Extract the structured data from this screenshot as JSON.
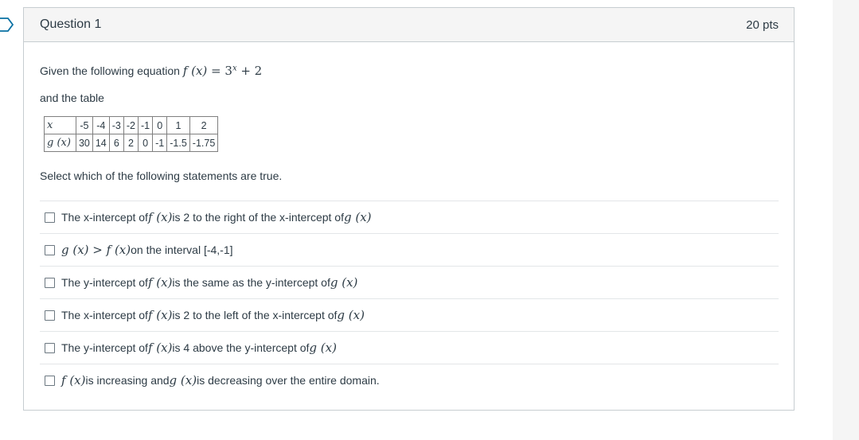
{
  "question": {
    "title": "Question 1",
    "points": "20 pts",
    "prompt_text": "Given the following equation",
    "equation": {
      "fx": "f (x)",
      "eq": " = 3",
      "exp": "x",
      "tail": " + 2"
    },
    "table_intro": "and the table",
    "table": {
      "row1_head": "x",
      "row1": [
        "-5",
        "-4",
        "-3",
        "-2",
        "-1",
        "0",
        "1",
        "2"
      ],
      "row2_head": "g (x)",
      "row2": [
        "30",
        "14",
        "6",
        "2",
        "0",
        "-1",
        "-1.5",
        "-1.75"
      ]
    },
    "select_instruction": "Select which of the following statements are true."
  },
  "answers": [
    {
      "pre": "The x-intercept of",
      "m1": "f (x)",
      "mid": " is 2 to the right of the x-intercept of ",
      "m2": "g (x)",
      "post": ""
    },
    {
      "pre": "",
      "m1": "g (x) > f (x)",
      "mid": " on the interval [-4,-1]",
      "m2": "",
      "post": ""
    },
    {
      "pre": "The y-intercept of ",
      "m1": "f (x)",
      "mid": " is the same as the y-intercept of ",
      "m2": "g (x)",
      "post": ""
    },
    {
      "pre": "The x-intercept of",
      "m1": "f (x)",
      "mid": " is 2 to the left of the x-intercept of ",
      "m2": "g (x)",
      "post": ""
    },
    {
      "pre": "The y-intercept of",
      "m1": "f (x)",
      "mid": " is 4 above the y-intercept of ",
      "m2": "g (x)",
      "post": ""
    },
    {
      "pre": "",
      "m1": "f (x)",
      "mid": " is increasing and ",
      "m2": "g (x)",
      "post": " is decreasing over the entire domain."
    }
  ],
  "colors": {
    "accent": "#0770a3",
    "header_bg": "#f5f5f5",
    "border": "#c7cdd1"
  }
}
